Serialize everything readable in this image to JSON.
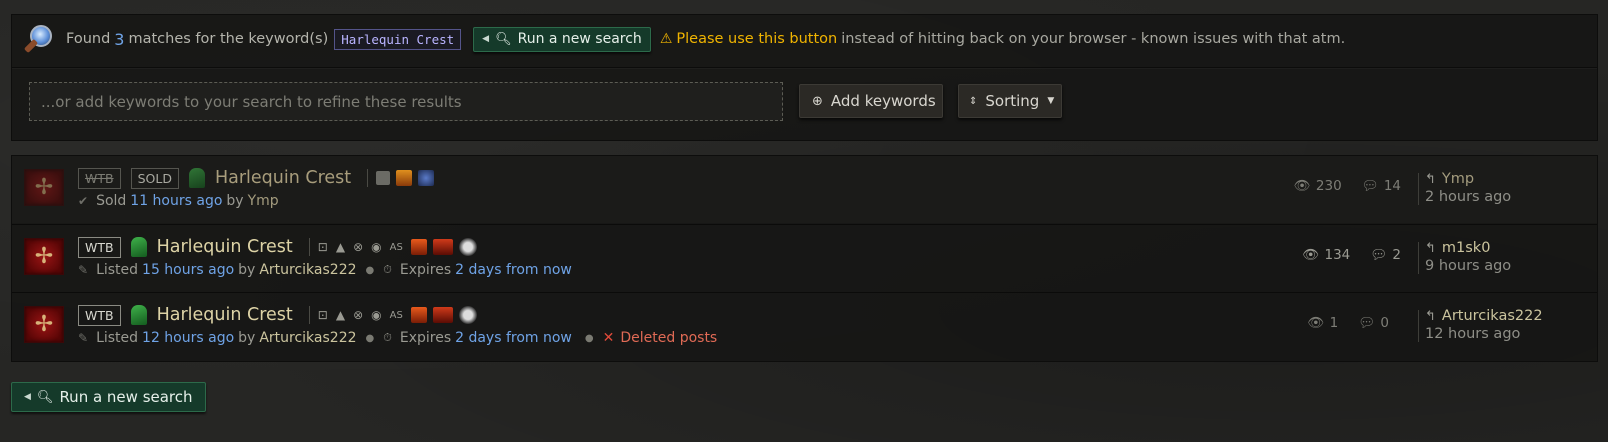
{
  "search": {
    "found_prefix": "Found",
    "count": "3",
    "matches_text": "matches for the keyword(s)",
    "keyword": "Harlequin Crest",
    "run_new_search_label": "Run a new search",
    "warning_link": "Please use this button",
    "warning_rest": "instead of hitting back on your browser - known issues with that atm.",
    "refine_placeholder": "...or add keywords to your search to refine these results",
    "add_keywords_label": "Add keywords",
    "sorting_label": "Sorting"
  },
  "results": [
    {
      "tag1": "WTB",
      "tag2": "SOLD",
      "item_name": "Harlequin Crest",
      "status_verb": "Sold",
      "time_ago": "11 hours ago",
      "by": "by",
      "author": "Ymp",
      "views": "230",
      "comments": "14",
      "last_user": "Ymp",
      "last_time": "2 hours ago"
    },
    {
      "tag1": "WTB",
      "item_name": "Harlequin Crest",
      "status_verb": "Listed",
      "time_ago": "15 hours ago",
      "by": "by",
      "author": "Arturcikas222",
      "expires_label": "Expires",
      "expires_value": "2 days from now",
      "as_label": "AS",
      "views": "134",
      "comments": "2",
      "last_user": "m1sk0",
      "last_time": "9 hours ago"
    },
    {
      "tag1": "WTB",
      "item_name": "Harlequin Crest",
      "status_verb": "Listed",
      "time_ago": "12 hours ago",
      "by": "by",
      "author": "Arturcikas222",
      "expires_label": "Expires",
      "expires_value": "2 days from now",
      "deleted_label": "Deleted posts",
      "as_label": "AS",
      "views": "1",
      "comments": "0",
      "last_user": "Arturcikas222",
      "last_time": "12 hours ago"
    }
  ],
  "footer": {
    "run_new_search_label": "Run a new search"
  },
  "colors": {
    "accent_blue": "#6fa3e6",
    "warning_yellow": "#f0b400",
    "button_green": "#153a2a",
    "deleted_red": "#e06a55"
  },
  "icons": [
    "search-logo-icon",
    "magnifier-icon",
    "warning-icon",
    "eye-icon",
    "comment-icon",
    "reply-arrow-icon",
    "check-icon",
    "feather-icon",
    "timer-icon",
    "close-icon",
    "helm-icon",
    "emblem-icon"
  ]
}
